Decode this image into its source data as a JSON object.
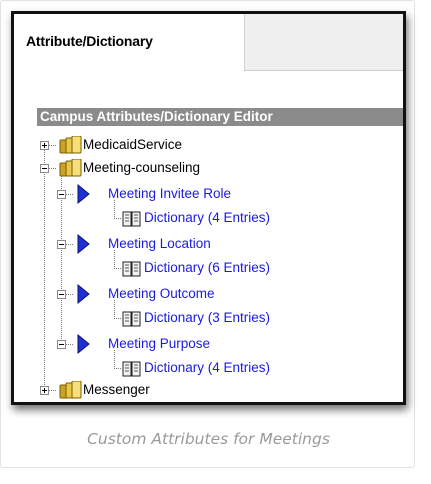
{
  "tab": {
    "label": "Attribute/Dictionary"
  },
  "panel": {
    "title": "Campus Attributes/Dictionary Editor"
  },
  "tree": {
    "items": [
      {
        "label": "MedicaidService"
      },
      {
        "label": "Meeting-counseling"
      },
      {
        "label": "Meeting Invitee Role"
      },
      {
        "label": "Dictionary (4 Entries)"
      },
      {
        "label": "Meeting Location"
      },
      {
        "label": "Dictionary (6 Entries)"
      },
      {
        "label": "Meeting Outcome"
      },
      {
        "label": "Dictionary (3 Entries)"
      },
      {
        "label": "Meeting Purpose"
      },
      {
        "label": "Dictionary (4 Entries)"
      },
      {
        "label": "Messenger"
      }
    ]
  },
  "caption": "Custom Attributes for Meetings",
  "colors": {
    "link": "#1a1ae6",
    "header_bg": "#8b8b8b",
    "arrow": "#1f2fd6",
    "folder": "#e8c84a"
  }
}
